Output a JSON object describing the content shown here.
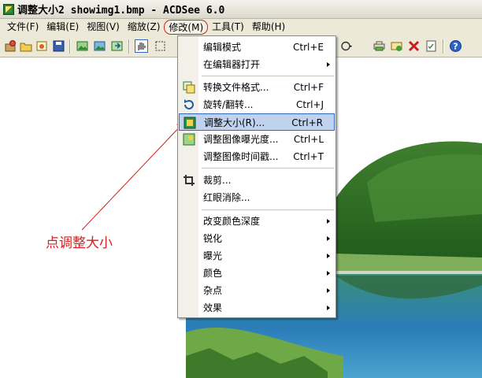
{
  "window": {
    "title": "调整大小2 showimg1.bmp - ACDSee 6.0"
  },
  "menubar": {
    "items": [
      {
        "label": "文件(F)",
        "name": "menu-file"
      },
      {
        "label": "编辑(E)",
        "name": "menu-edit"
      },
      {
        "label": "视图(V)",
        "name": "menu-view"
      },
      {
        "label": "缩放(Z)",
        "name": "menu-zoom"
      },
      {
        "label": "修改(M)",
        "name": "menu-modify"
      },
      {
        "label": "工具(T)",
        "name": "menu-tools"
      },
      {
        "label": "帮助(H)",
        "name": "menu-help"
      }
    ]
  },
  "dropdown": {
    "items": [
      {
        "label": "编辑模式",
        "shortcut": "Ctrl+E"
      },
      {
        "label": "在编辑器打开",
        "submenu": true
      },
      {
        "label": "转换文件格式...",
        "shortcut": "Ctrl+F",
        "icon": "convert-format-icon"
      },
      {
        "label": "旋转/翻转...",
        "shortcut": "Ctrl+J",
        "icon": "rotate-icon"
      },
      {
        "label": "调整大小(R)...",
        "shortcut": "Ctrl+R",
        "icon": "resize-icon",
        "highlighted": true
      },
      {
        "label": "调整图像曝光度...",
        "shortcut": "Ctrl+L",
        "icon": "exposure-icon"
      },
      {
        "label": "调整图像时间戳...",
        "shortcut": "Ctrl+T"
      },
      {
        "label": "裁剪...",
        "icon": "crop-icon"
      },
      {
        "label": "红眼消除..."
      },
      {
        "label": "改变颜色深度",
        "submenu": true
      },
      {
        "label": "锐化",
        "submenu": true
      },
      {
        "label": "曝光",
        "submenu": true
      },
      {
        "label": "颜色",
        "submenu": true
      },
      {
        "label": "杂点",
        "submenu": true
      },
      {
        "label": "效果",
        "submenu": true
      }
    ]
  },
  "annotation": {
    "text": "点调整大小"
  },
  "colors": {
    "menu_bg": "#ece9d8",
    "highlight_bg": "#c1d2ee",
    "highlight_border": "#316ac5",
    "annotation": "#d42020"
  }
}
